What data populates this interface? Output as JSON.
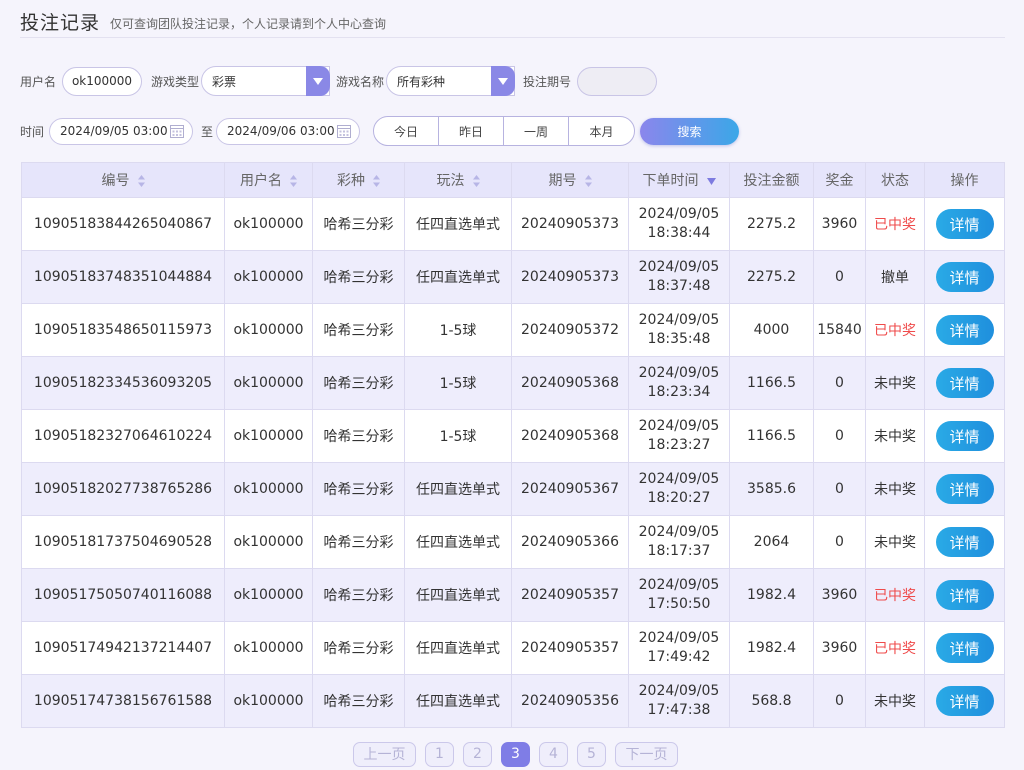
{
  "header": {
    "title": "投注记录",
    "subtitle": "仅可查询团队投注记录，个人记录请到个人中心查询"
  },
  "filters": {
    "username_label": "用户名",
    "username_value": "ok100000",
    "game_type_label": "游戏类型",
    "game_type_value": "彩票",
    "game_name_label": "游戏名称",
    "game_name_value": "所有彩种",
    "period_label": "投注期号",
    "period_value": "",
    "time_label": "时间",
    "start_time": "2024/09/05 03:00",
    "to_label": "至",
    "end_time": "2024/09/06 03:00",
    "quick": [
      "今日",
      "昨日",
      "一周",
      "本月"
    ],
    "search_label": "搜索"
  },
  "table": {
    "columns": [
      "编号",
      "用户名",
      "彩种",
      "玩法",
      "期号",
      "下单时间",
      "投注金额",
      "奖金",
      "状态",
      "操作"
    ],
    "detail_label": "详情",
    "rows": [
      {
        "id": "1090518384426504086​7",
        "user": "ok100000",
        "lottery": "哈希三分彩",
        "play": "任四直选单式",
        "period": "20240905373",
        "date": "2024/09/05",
        "time": "18:38:44",
        "amount": "2275.2",
        "bonus": "3960",
        "status": "已中奖",
        "status_color": "#ef4b4b"
      },
      {
        "id": "10905183748351044884",
        "user": "ok100000",
        "lottery": "哈希三分彩",
        "play": "任四直选单式",
        "period": "20240905373",
        "date": "2024/09/05",
        "time": "18:37:48",
        "amount": "2275.2",
        "bonus": "0",
        "status": "撤单",
        "status_color": "#333333"
      },
      {
        "id": "10905183548650115973",
        "user": "ok100000",
        "lottery": "哈希三分彩",
        "play": "1-5球",
        "period": "20240905372",
        "date": "2024/09/05",
        "time": "18:35:48",
        "amount": "4000",
        "bonus": "15840",
        "status": "已中奖",
        "status_color": "#ef4b4b"
      },
      {
        "id": "10905182334536093205",
        "user": "ok100000",
        "lottery": "哈希三分彩",
        "play": "1-5球",
        "period": "20240905368",
        "date": "2024/09/05",
        "time": "18:23:34",
        "amount": "1166.5",
        "bonus": "0",
        "status": "未中奖",
        "status_color": "#333333"
      },
      {
        "id": "10905182327064610224",
        "user": "ok100000",
        "lottery": "哈希三分彩",
        "play": "1-5球",
        "period": "20240905368",
        "date": "2024/09/05",
        "time": "18:23:27",
        "amount": "1166.5",
        "bonus": "0",
        "status": "未中奖",
        "status_color": "#333333"
      },
      {
        "id": "10905182027738765286",
        "user": "ok100000",
        "lottery": "哈希三分彩",
        "play": "任四直选单式",
        "period": "20240905367",
        "date": "2024/09/05",
        "time": "18:20:27",
        "amount": "3585.6",
        "bonus": "0",
        "status": "未中奖",
        "status_color": "#333333"
      },
      {
        "id": "10905181737504690528",
        "user": "ok100000",
        "lottery": "哈希三分彩",
        "play": "任四直选单式",
        "period": "20240905366",
        "date": "2024/09/05",
        "time": "18:17:37",
        "amount": "2064",
        "bonus": "0",
        "status": "未中奖",
        "status_color": "#333333"
      },
      {
        "id": "10905175050740116088",
        "user": "ok100000",
        "lottery": "哈希三分彩",
        "play": "任四直选单式",
        "period": "20240905357",
        "date": "2024/09/05",
        "time": "17:50:50",
        "amount": "1982.4",
        "bonus": "3960",
        "status": "已中奖",
        "status_color": "#ef4b4b"
      },
      {
        "id": "10905174942137214407",
        "user": "ok100000",
        "lottery": "哈希三分彩",
        "play": "任四直选单式",
        "period": "20240905357",
        "date": "2024/09/05",
        "time": "17:49:42",
        "amount": "1982.4",
        "bonus": "3960",
        "status": "已中奖",
        "status_color": "#ef4b4b"
      },
      {
        "id": "10905174738156761588",
        "user": "ok100000",
        "lottery": "哈希三分彩",
        "play": "任四直选单式",
        "period": "20240905356",
        "date": "2024/09/05",
        "time": "17:47:38",
        "amount": "568.8",
        "bonus": "0",
        "status": "未中奖",
        "status_color": "#333333"
      }
    ]
  },
  "pagination": {
    "prev_label": "上一页",
    "pages": [
      "1",
      "2",
      "3",
      "4",
      "5"
    ],
    "current": "3",
    "next_label": "下一页"
  },
  "colors": {
    "accent": "#8a88e6",
    "win": "#ef4b4b",
    "detail_button": "#1f8fdd"
  }
}
